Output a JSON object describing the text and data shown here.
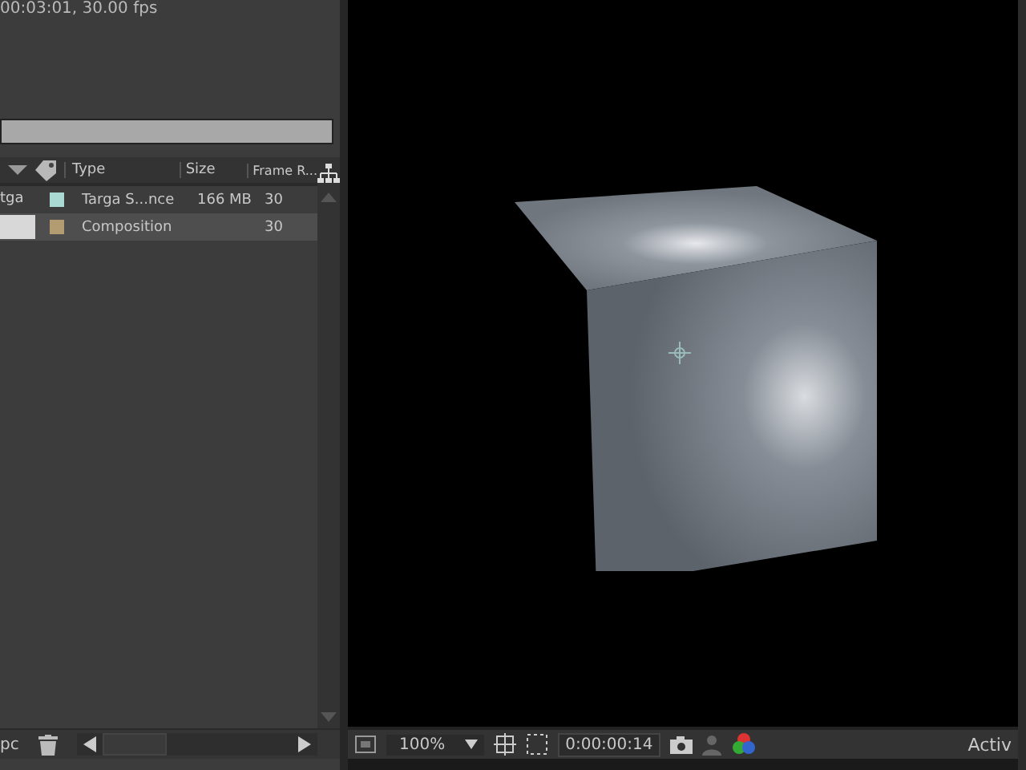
{
  "project_panel": {
    "info": "00:03:01, 30.00 fps",
    "columns": [
      "Type",
      "Size",
      "Frame R..."
    ],
    "items": [
      {
        "name": "tga",
        "color": "#a9d9d2",
        "type": "Targa S...nce",
        "size": "166 MB",
        "frame_rate": "30",
        "selected": false
      },
      {
        "color": "#b39b72",
        "type": "Composition",
        "frame_rate": "30",
        "selected": true
      }
    ],
    "footer_label": "pc"
  },
  "viewer": {
    "zoom": "100%",
    "timecode": "0:00:00:14",
    "active_label": "Activ"
  }
}
